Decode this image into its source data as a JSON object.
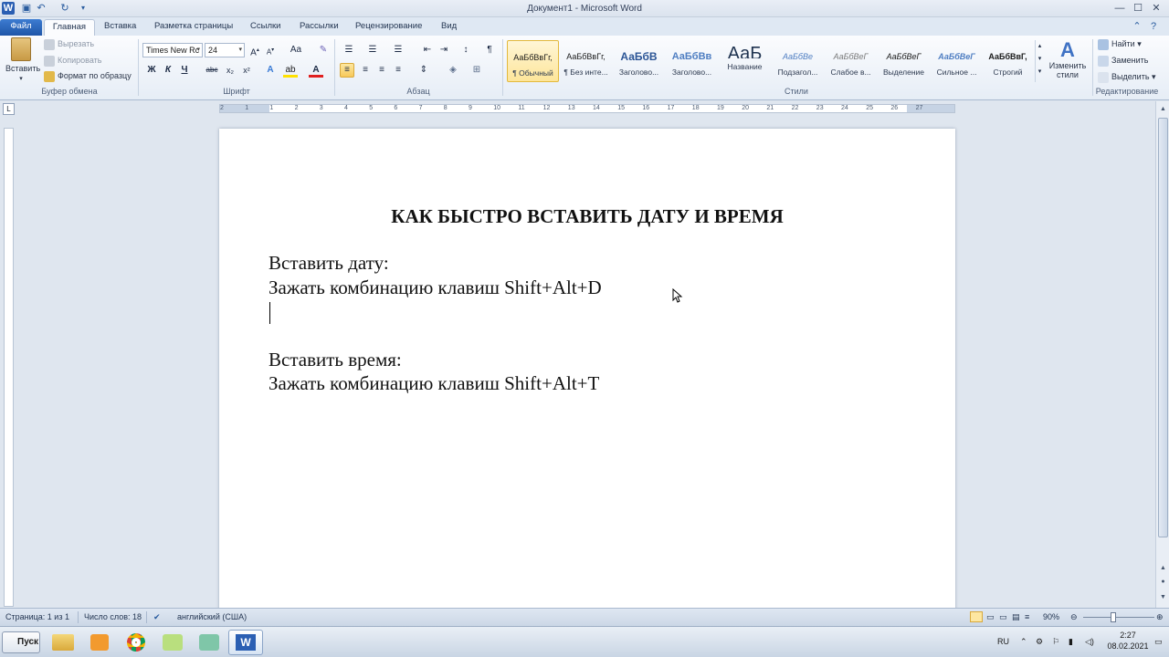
{
  "window": {
    "title": "Документ1 - Microsoft Word",
    "controls": {
      "minimize": "—",
      "maximize": "☐",
      "close": "✕"
    }
  },
  "quick_access": {
    "save_icon": "save-icon",
    "undo_icon": "undo-icon",
    "redo_icon": "redo-icon"
  },
  "tabs": [
    {
      "label": "Файл"
    },
    {
      "label": "Главная"
    },
    {
      "label": "Вставка"
    },
    {
      "label": "Разметка страницы"
    },
    {
      "label": "Ссылки"
    },
    {
      "label": "Рассылки"
    },
    {
      "label": "Рецензирование"
    },
    {
      "label": "Вид"
    }
  ],
  "ribbon": {
    "clipboard": {
      "group_label": "Буфер обмена",
      "paste": "Вставить",
      "cut": "Вырезать",
      "copy": "Копировать",
      "format_painter": "Формат по образцу"
    },
    "font": {
      "group_label": "Шрифт",
      "font_name": "Times New Rc",
      "font_size": "24",
      "bold": "Ж",
      "italic": "К",
      "underline": "Ч",
      "strike": "abc",
      "case": "Aa"
    },
    "paragraph": {
      "group_label": "Абзац"
    },
    "styles": {
      "group_label": "Стили",
      "items": [
        {
          "sample": "АаБбВвГг,",
          "name": "¶ Обычный"
        },
        {
          "sample": "АаБбВвГг,",
          "name": "¶ Без инте..."
        },
        {
          "sample": "АаБбВ",
          "name": "Заголово..."
        },
        {
          "sample": "АаБбВв",
          "name": "Заголово..."
        },
        {
          "sample": "АаБ",
          "name": "Название"
        },
        {
          "sample": "АаБбВе",
          "name": "Подзагол..."
        },
        {
          "sample": "АаБбВеГ",
          "name": "Слабое в..."
        },
        {
          "sample": "АаБбВеГ",
          "name": "Выделение"
        },
        {
          "sample": "АаБбВеГ",
          "name": "Сильное ..."
        },
        {
          "sample": "АаБбВвГ,",
          "name": "Строгий"
        }
      ],
      "change_styles": "Изменить стили"
    },
    "editing": {
      "group_label": "Редактирование",
      "find": "Найти",
      "replace": "Заменить",
      "select": "Выделить"
    }
  },
  "ruler": {
    "numbers": [
      "2",
      "1",
      "1",
      "2",
      "3",
      "4",
      "5",
      "6",
      "7",
      "8",
      "9",
      "10",
      "11",
      "12",
      "13",
      "14",
      "15",
      "16",
      "17",
      "18",
      "19",
      "20",
      "21",
      "22",
      "23",
      "24",
      "25",
      "26",
      "27"
    ]
  },
  "document": {
    "title": "КАК БЫСТРО ВСТАВИТЬ ДАТУ И ВРЕМЯ",
    "lines": [
      "Вставить дату:",
      "Зажать комбинацию клавиш Shift+Alt+D",
      "",
      "",
      "Вставить время:",
      "Зажать комбинацию клавиш Shift+Alt+T"
    ]
  },
  "status": {
    "page": "Страница: 1 из 1",
    "words": "Число слов: 18",
    "language": "английский (США)",
    "zoom": "90%"
  },
  "taskbar": {
    "start": "Пуск",
    "lang": "RU",
    "time": "2:27",
    "date": "08.02.2021"
  }
}
